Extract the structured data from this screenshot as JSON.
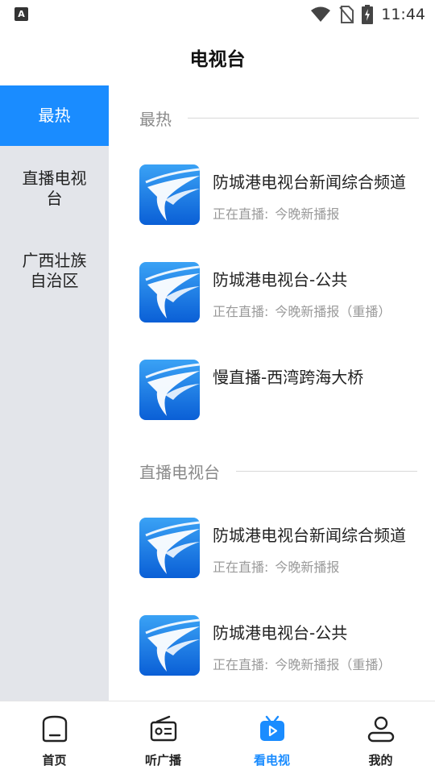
{
  "status_bar": {
    "left_badge": "A",
    "time": "11:44",
    "icons": [
      "wifi-icon",
      "no-sim-icon",
      "battery-charging-icon"
    ]
  },
  "header": {
    "title": "电视台"
  },
  "sidebar": {
    "items": [
      {
        "label": "最热",
        "active": true
      },
      {
        "label": "直播电视台",
        "active": false
      },
      {
        "label": "广西壮族自治区",
        "active": false
      }
    ]
  },
  "sections": [
    {
      "title": "最热",
      "channels": [
        {
          "name": "防城港电视台新闻综合频道",
          "live_prefix": "正在直播:",
          "program": "今晚新播报"
        },
        {
          "name": "防城港电视台-公共",
          "live_prefix": "正在直播:",
          "program": "今晚新播报（重播）"
        },
        {
          "name": "慢直播-西湾跨海大桥",
          "live_prefix": "",
          "program": ""
        }
      ]
    },
    {
      "title": "直播电视台",
      "channels": [
        {
          "name": "防城港电视台新闻综合频道",
          "live_prefix": "正在直播:",
          "program": "今晚新播报"
        },
        {
          "name": "防城港电视台-公共",
          "live_prefix": "正在直播:",
          "program": "今晚新播报（重播）"
        }
      ]
    }
  ],
  "tab_bar": {
    "tabs": [
      {
        "label": "首页",
        "icon": "home-icon",
        "active": false
      },
      {
        "label": "听广播",
        "icon": "radio-icon",
        "active": false
      },
      {
        "label": "看电视",
        "icon": "tv-icon",
        "active": true
      },
      {
        "label": "我的",
        "icon": "profile-icon",
        "active": false
      }
    ]
  },
  "colors": {
    "accent": "#1a8cff",
    "sidebar_bg": "#e3e5ea",
    "muted_text": "#9a9a9a"
  }
}
